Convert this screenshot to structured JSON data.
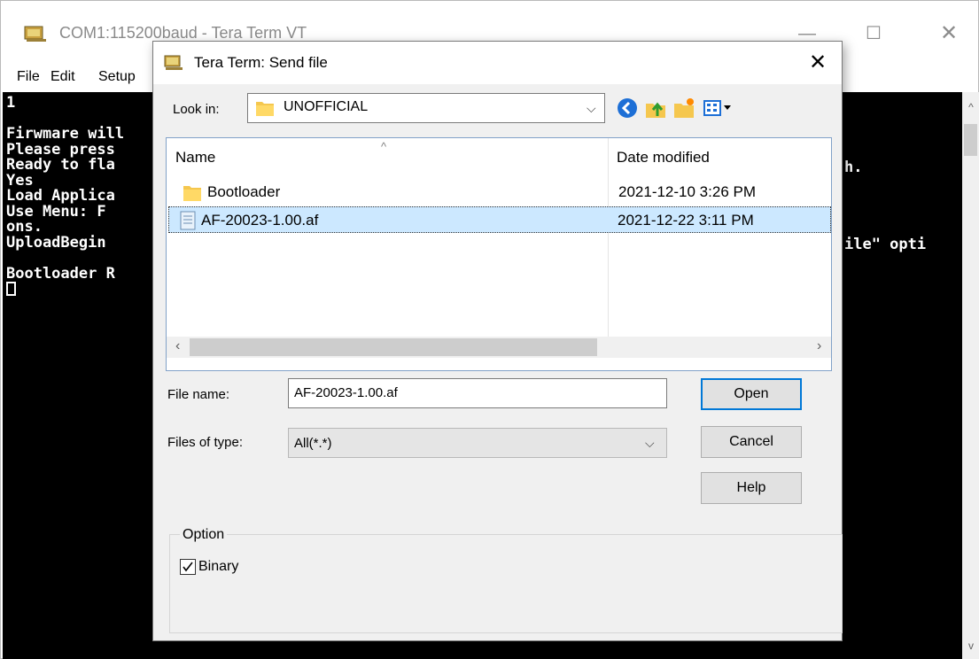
{
  "main_window": {
    "title": "COM1:115200baud - Tera Term VT",
    "window_controls": {
      "minimize": "—",
      "maximize": "☐",
      "close": "✕"
    },
    "menu": [
      {
        "label": "File",
        "accel": "F"
      },
      {
        "label": "Edit",
        "accel": "E"
      },
      {
        "label": "Setup",
        "accel": "S"
      }
    ],
    "terminal_lines": [
      "1",
      "",
      "Firwmare will",
      "Please press",
      "Ready to fla",
      "Yes",
      "Load Applica",
      "Use Menu: F",
      "ons.",
      "UploadBegin",
      "",
      "Bootloader R"
    ],
    "terminal_right_fragments": [
      "h.",
      "ile\" opti"
    ],
    "scroll_up": "^",
    "scroll_down": "v"
  },
  "dialog": {
    "title": "Tera Term: Send file",
    "close": "✕",
    "look_in_label": "Look in:",
    "look_in_value": "UNOFFICIAL",
    "toolbar_icons": [
      "back-icon",
      "up-folder-icon",
      "new-folder-icon",
      "view-menu-icon"
    ],
    "columns": {
      "name": "Name",
      "date_modified": "Date modified"
    },
    "files": [
      {
        "name": "Bootloader",
        "date": "2021-12-10 3:26 PM",
        "type": "folder",
        "selected": false
      },
      {
        "name": "AF-20023-1.00.af",
        "date": "2021-12-22 3:11 PM",
        "type": "file",
        "selected": true
      }
    ],
    "file_name_label": "File name:",
    "file_name_value": "AF-20023-1.00.af",
    "files_of_type_label": "Files of type:",
    "files_of_type_value": "All(*.*)",
    "buttons": {
      "open": "Open",
      "cancel": "Cancel",
      "help": "Help"
    },
    "option_group_title": "Option",
    "binary_label": "Binary",
    "binary_checked": true
  }
}
